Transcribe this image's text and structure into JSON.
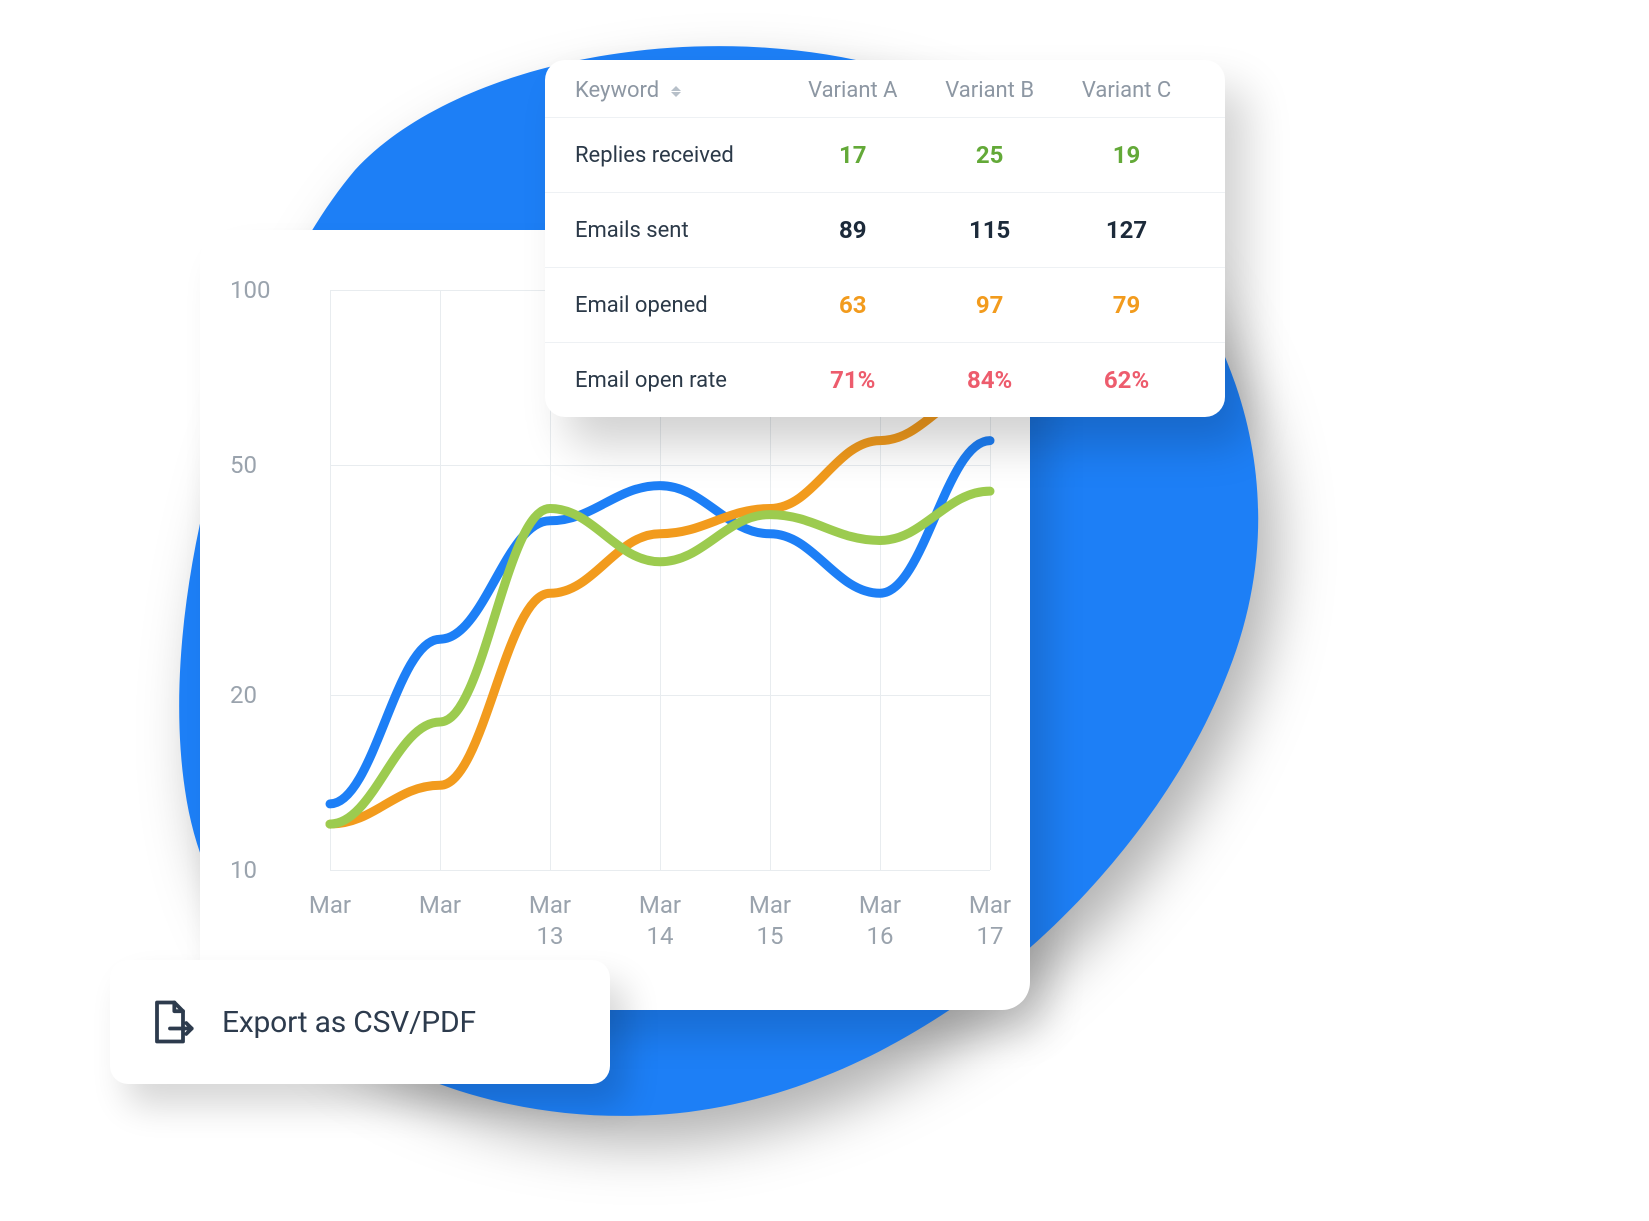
{
  "colors": {
    "blob": "#1d7ff6",
    "blue": "#1d7ff6",
    "orange": "#f29b1d",
    "green_line": "#9ccb4f",
    "row_green": "#63a938",
    "row_dark": "#1c2a3a",
    "row_orange": "#f29b1d",
    "row_red": "#ed5c6d"
  },
  "table": {
    "headers": {
      "keyword": "Keyword",
      "variantA": "Variant A",
      "variantB": "Variant B",
      "variantC": "Variant C"
    },
    "rows": [
      {
        "label": "Replies received",
        "a": "17",
        "b": "25",
        "c": "19",
        "color": "green"
      },
      {
        "label": "Emails sent",
        "a": "89",
        "b": "115",
        "c": "127",
        "color": "dark"
      },
      {
        "label": "Email opened",
        "a": "63",
        "b": "97",
        "c": "79",
        "color": "orange"
      },
      {
        "label": "Email open rate",
        "a": "71%",
        "b": "84%",
        "c": "62%",
        "color": "red"
      }
    ]
  },
  "export": {
    "label": "Export as CSV/PDF"
  },
  "chart_data": {
    "type": "line",
    "title": "",
    "xlabel": "",
    "ylabel": "",
    "ylim": [
      10,
      100
    ],
    "yticks": [
      10,
      20,
      50,
      100
    ],
    "categories": [
      "Mar",
      "Mar",
      "Mar 13",
      "Mar 14",
      "Mar 15",
      "Mar 16",
      "Mar 17"
    ],
    "series": [
      {
        "name": "Variant A",
        "color": "#1d7ff6",
        "values": [
          13,
          25,
          40,
          46,
          38,
          30,
          55
        ]
      },
      {
        "name": "Variant B",
        "color": "#f29b1d",
        "values": [
          12,
          14,
          30,
          38,
          42,
          55,
          68
        ]
      },
      {
        "name": "Variant C",
        "color": "#9ccb4f",
        "values": [
          12,
          18,
          42,
          34,
          41,
          37,
          45
        ]
      }
    ]
  }
}
